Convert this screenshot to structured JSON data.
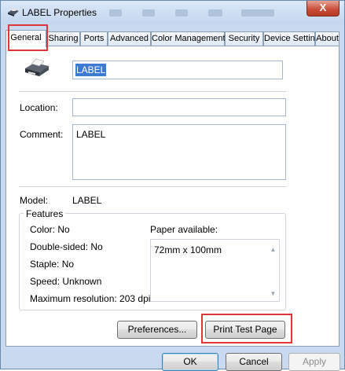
{
  "window": {
    "title": "LABEL Properties",
    "close_glyph": "X"
  },
  "tabs": [
    {
      "label": "General",
      "active": true
    },
    {
      "label": "Sharing"
    },
    {
      "label": "Ports"
    },
    {
      "label": "Advanced"
    },
    {
      "label": "Color Management"
    },
    {
      "label": "Security"
    },
    {
      "label": "Device Settings"
    },
    {
      "label": "About"
    }
  ],
  "general": {
    "printer_name": "LABEL",
    "location_label": "Location:",
    "location_value": "",
    "comment_label": "Comment:",
    "comment_value": "LABEL",
    "model_label": "Model:",
    "model_value": "LABEL",
    "features_label": "Features",
    "features": {
      "color": "Color: No",
      "double_sided": "Double-sided: No",
      "staple": "Staple: No",
      "speed": "Speed: Unknown",
      "max_resolution": "Maximum resolution: 203 dpi"
    },
    "paper_available_label": "Paper available:",
    "paper_sizes": [
      "72mm x 100mm"
    ],
    "preferences_button": "Preferences...",
    "print_test_page_button": "Print Test Page"
  },
  "footer": {
    "ok": "OK",
    "cancel": "Cancel",
    "apply": "Apply"
  },
  "icons": {
    "printer": "printer-icon",
    "scroll_up": "scroll-up-icon",
    "scroll_down": "scroll-down-icon"
  },
  "colors": {
    "highlight_box": "#e0363a",
    "selection": "#3b7bd6"
  }
}
